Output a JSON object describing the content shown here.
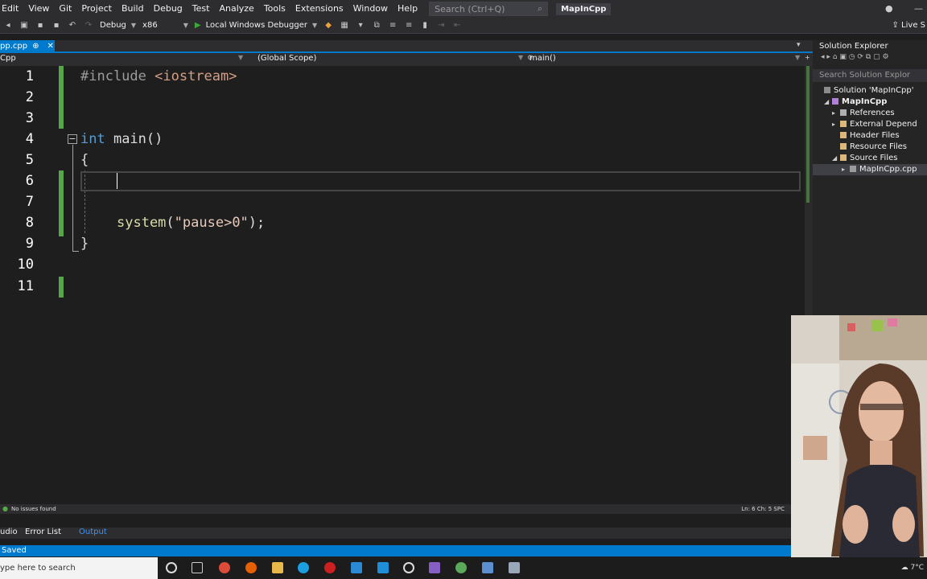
{
  "menu": {
    "items": [
      "Edit",
      "View",
      "Git",
      "Project",
      "Build",
      "Debug",
      "Test",
      "Analyze",
      "Tools",
      "Extensions",
      "Window",
      "Help"
    ],
    "search_placeholder": "Search (Ctrl+Q)",
    "solution_name": "MapInCpp"
  },
  "toolbar": {
    "config": "Debug",
    "platform": "x86",
    "run_label": "Local Windows Debugger",
    "live_share": "Live S"
  },
  "doc_tab": {
    "label": "pp.cpp",
    "pin": "⊕",
    "close": "✕"
  },
  "navbar": {
    "project": "Cpp",
    "scope": "(Global Scope)",
    "function": "main()"
  },
  "editor": {
    "line_numbers": [
      "1",
      "2",
      "3",
      "4",
      "5",
      "6",
      "7",
      "8",
      "9",
      "10",
      "11"
    ],
    "line1_directive": "#include",
    "line1_header": " <iostream>",
    "line4_kw": "int",
    "line4_rest": " main()",
    "line5": "{",
    "line8_fn": "system",
    "line8_open": "(",
    "line8_str": "\"pause>0\"",
    "line8_close": ");",
    "line9": "}"
  },
  "status": {
    "issues": "No issues found",
    "position": "Ln: 6   Ch: 5   SPC",
    "panel_tabs": [
      "udio",
      "Error List",
      "Output"
    ],
    "saved": "Saved"
  },
  "taskbar": {
    "search_text": "ype here to search",
    "temperature": "7°C"
  },
  "solution_explorer": {
    "title": "Solution Explorer",
    "search_placeholder": "Search Solution Explor",
    "solution": "Solution 'MapInCpp'",
    "project": "MapInCpp",
    "items": [
      "References",
      "External Depend",
      "Header Files",
      "Resource Files",
      "Source Files"
    ],
    "file": "MapInCpp.cpp"
  }
}
